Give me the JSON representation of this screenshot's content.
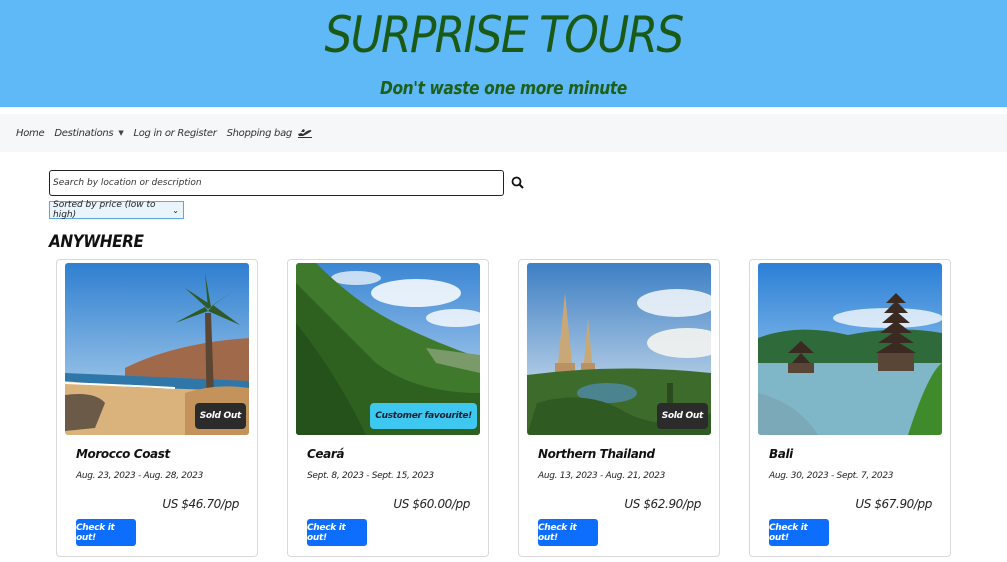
{
  "hero": {
    "title": "SURPRISE TOURS",
    "subtitle": "Don't waste one more minute"
  },
  "nav": {
    "items": [
      {
        "label": "Home"
      },
      {
        "label": "Destinations",
        "has_dropdown": true
      },
      {
        "label": "Log in or Register"
      },
      {
        "label": "Shopping bag",
        "icon": "airplane-icon"
      }
    ]
  },
  "search": {
    "placeholder": "Search by location or description",
    "icon": "search-icon"
  },
  "sort": {
    "selected": "Sorted by price (low to high)"
  },
  "section": {
    "heading": "ANYWHERE"
  },
  "cards": [
    {
      "name": "Morocco Coast",
      "dates": "Aug. 23, 2023 - Aug. 28, 2023",
      "price": "US $46.70/pp",
      "badge": "Sold Out",
      "button": "Check it out!"
    },
    {
      "name": "Ceará",
      "dates": "Sept. 8, 2023 - Sept. 15, 2023",
      "price": "US $60.00/pp",
      "badge": "Customer favourite!",
      "button": "Check it out!"
    },
    {
      "name": "Northern Thailand",
      "dates": "Aug. 13, 2023 - Aug. 21, 2023",
      "price": "US $62.90/pp",
      "badge": "Sold Out",
      "button": "Check it out!"
    },
    {
      "name": "Bali",
      "dates": "Aug. 30, 2023 - Sept. 7, 2023",
      "price": "US $67.90/pp",
      "badge": "",
      "button": "Check it out!"
    }
  ],
  "colors": {
    "hero_bg": "#5fb9f7",
    "hero_text": "#1a5a16",
    "button": "#0d6efd",
    "badge_dark": "#2b2b2b",
    "badge_cyan": "#3ec7ef"
  }
}
